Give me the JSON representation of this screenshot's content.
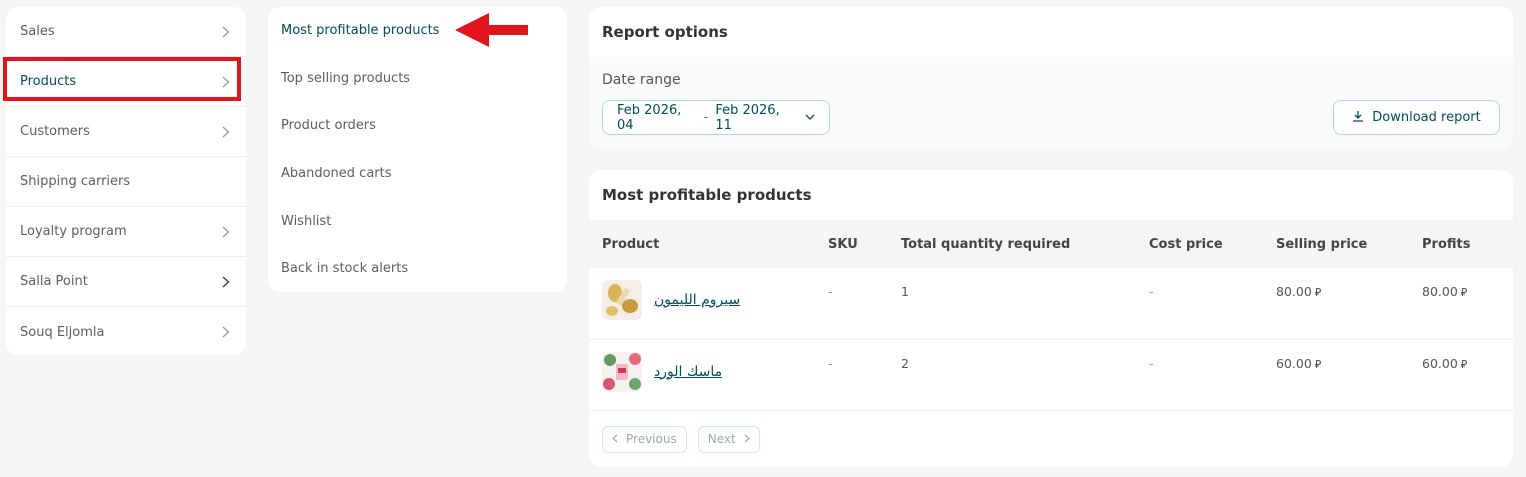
{
  "left_nav": {
    "items": [
      {
        "label": "Sales",
        "has_chevron": true
      },
      {
        "label": "Products",
        "has_chevron": true
      },
      {
        "label": "Customers",
        "has_chevron": true
      },
      {
        "label": "Shipping carriers",
        "has_chevron": false
      },
      {
        "label": "Loyalty program",
        "has_chevron": true
      },
      {
        "label": "Salla Point",
        "has_chevron": true
      },
      {
        "label": "Souq Eljomla",
        "has_chevron": true
      }
    ],
    "active_index": 1
  },
  "sub_nav": {
    "items": [
      {
        "label": "Most profitable products"
      },
      {
        "label": "Top selling products"
      },
      {
        "label": "Product orders"
      },
      {
        "label": "Abandoned carts"
      },
      {
        "label": "Wishlist"
      },
      {
        "label": "Back in stock alerts"
      }
    ],
    "active_index": 0
  },
  "report_options": {
    "title": "Report options",
    "date_range_label": "Date range",
    "date_from": "Feb 2026, 04",
    "date_separator": "-",
    "date_to": "Feb 2026, 11",
    "download_label": "Download report"
  },
  "table": {
    "title": "Most profitable products",
    "headers": {
      "product": "Product",
      "sku": "SKU",
      "qty": "Total quantity required",
      "cost": "Cost price",
      "selling": "Selling price",
      "profits": "Profits"
    },
    "currency_symbol": "⃁",
    "rows": [
      {
        "name": "سيروم الليمون",
        "sku": "-",
        "qty": "1",
        "cost": "-",
        "selling": "80.00",
        "profits": "80.00",
        "thumb_icon": "lemon-serum-image"
      },
      {
        "name": "ماسك الورد",
        "sku": "-",
        "qty": "2",
        "cost": "-",
        "selling": "60.00",
        "profits": "60.00",
        "thumb_icon": "rose-mask-image"
      }
    ],
    "pagination": {
      "previous": "Previous",
      "next": "Next"
    }
  },
  "colors": {
    "accent": "#004d5a",
    "border_teal": "#9fe3d8",
    "highlight": "#e3141b"
  }
}
